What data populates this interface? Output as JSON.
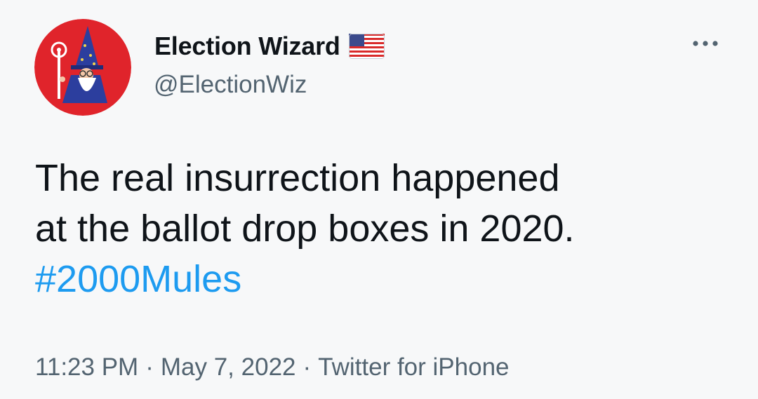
{
  "author": {
    "display_name": "Election Wizard",
    "handle": "@ElectionWiz",
    "flag_icon": "us-flag-icon",
    "avatar_icon": "wizard-avatar-icon"
  },
  "menu": {
    "more_icon": "more-horizontal-icon"
  },
  "tweet": {
    "line1": "The real insurrection happened",
    "line2": "at the ballot drop boxes in 2020.",
    "hashtag": "#2000Mules"
  },
  "meta": {
    "time": "11:23 PM",
    "separator": "·",
    "date": "May 7, 2022",
    "source": "Twitter for iPhone"
  },
  "colors": {
    "text_primary": "#0f1419",
    "text_secondary": "#536471",
    "link": "#1d9bf0",
    "avatar_bg": "#e0242b",
    "background": "#f7f8f9"
  }
}
